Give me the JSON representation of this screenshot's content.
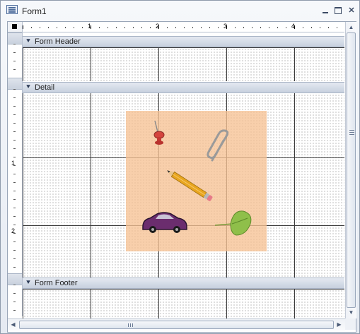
{
  "window": {
    "title": "Form1",
    "icon": "form-icon",
    "controls": [
      "minimize-icon",
      "restore-icon",
      "close-icon"
    ]
  },
  "ruler": {
    "horizontal_ticks": [
      "1",
      "2",
      "3",
      "4"
    ],
    "vertical_ticks": [
      "1",
      "2"
    ]
  },
  "sections": {
    "header_label": "Form Header",
    "detail_label": "Detail",
    "footer_label": "Form Footer",
    "expand_glyph": "section-selector-icon"
  },
  "image_control": {
    "background": "#f6c194",
    "objects": [
      "pushpin-icon",
      "paperclip-icon",
      "pencil-icon",
      "car-icon",
      "leaf-icon"
    ]
  },
  "scrollbars": {
    "up_arrow": "▲",
    "down_arrow": "▼",
    "left_arrow": "◀",
    "right_arrow": "▶"
  },
  "colors": {
    "grid_line": "#3a3a3a",
    "section_bar": "#c7d0de",
    "title_text": "#1f1f1f"
  }
}
